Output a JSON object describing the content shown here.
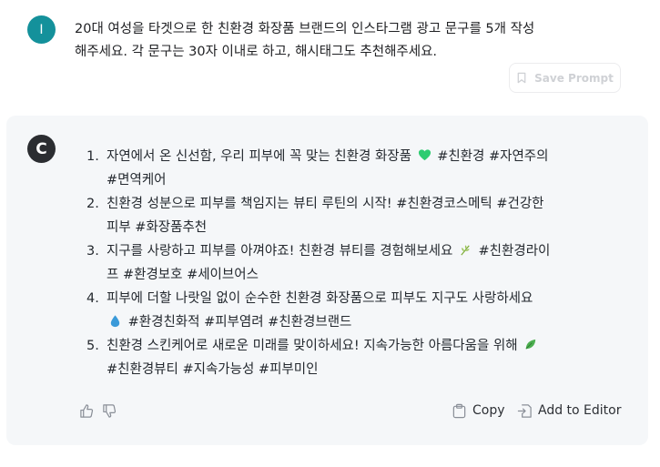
{
  "user": {
    "avatar_initial": "I",
    "message_line1": "20대 여성을 타겟으로 한 친환경 화장품 브랜드의 인스타그램 광고 문구를 5개 작성",
    "message_line2": "해주세요. 각 문구는 30자 이내로 하고, 해시태그도 추천해주세요.",
    "save_prompt_label": "Save Prompt"
  },
  "assistant": {
    "avatar_initial": "C",
    "items": [
      {
        "num": "1.",
        "text": "자연에서 온 신선함, 우리 피부에 꼭 맞는 친환경 화장품",
        "emoji": "green-heart-icon",
        "tags_inline": "#친환경 #자연주의",
        "tags_wrap": "#면역케어"
      },
      {
        "num": "2.",
        "line1": "친환경 성분으로 피부를 책임지는 뷰티 루틴의 시작! #친환경코스메틱 #건강한",
        "line2": "피부 #화장품추천"
      },
      {
        "num": "3.",
        "text": "지구를 사랑하고 피부를 아껴야죠! 친환경 뷰티를 경험해보세요",
        "emoji": "herb-icon",
        "tags_inline": "#친환경라이",
        "tags_wrap": "프 #환경보호 #세이브어스"
      },
      {
        "num": "4.",
        "line1": "피부에 더할 나랏일 없이 순수한 친환경 화장품으로 피부도 지구도 사랑하세요",
        "emoji": "droplet-icon",
        "tags_wrap": "#환경친화적 #피부염려 #친환경브랜드"
      },
      {
        "num": "5.",
        "line1": "친환경 스킨케어로 새로운 미래를 맞이하세요! 지속가능한 아름다움을 위해",
        "emoji": "leaf-icon",
        "tags_wrap": "#친환경뷰티 #지속가능성 #피부미인"
      }
    ],
    "copy_label": "Copy",
    "editor_label": "Add to Editor"
  },
  "colors": {
    "user_avatar": "#14919b",
    "assistant_avatar": "#2b2d31",
    "card_bg": "#f5f7f9",
    "emoji_green": "#2ecc71",
    "droplet_blue": "#3a9ad9"
  }
}
